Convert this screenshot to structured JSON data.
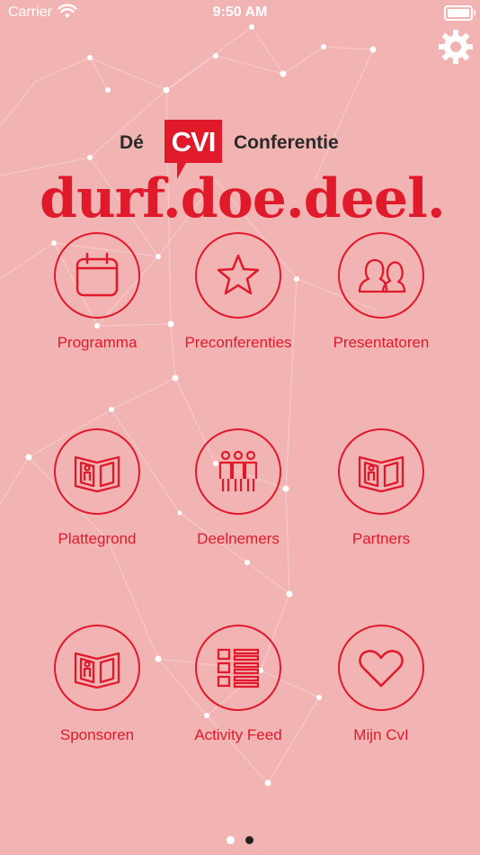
{
  "status_bar": {
    "carrier": "Carrier",
    "time": "9:50 AM"
  },
  "logo": {
    "prefix": "Dé",
    "badge": "CVI",
    "suffix": "Conferentie",
    "slogan": "durf.doe.deel."
  },
  "tiles": [
    {
      "label": "Programma",
      "icon": "calendar-icon"
    },
    {
      "label": "Preconferenties",
      "icon": "star-icon"
    },
    {
      "label": "Presentatoren",
      "icon": "people-icon"
    },
    {
      "label": "Plattegrond",
      "icon": "floorplan-icon"
    },
    {
      "label": "Deelnemers",
      "icon": "group-icon"
    },
    {
      "label": "Partners",
      "icon": "floorplan-icon"
    },
    {
      "label": "Sponsoren",
      "icon": "floorplan-icon"
    },
    {
      "label": "Activity Feed",
      "icon": "feed-icon"
    },
    {
      "label": "Mijn CvI",
      "icon": "heart-icon"
    }
  ],
  "page_indicator": {
    "current": 2,
    "total": 2
  },
  "colors": {
    "accent": "#e0192b",
    "background": "#f2b3b3"
  }
}
